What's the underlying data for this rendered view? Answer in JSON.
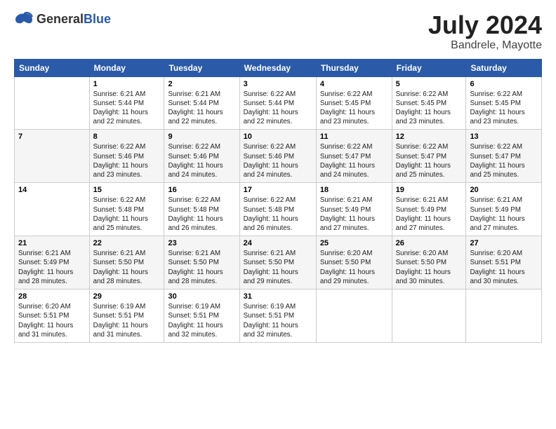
{
  "logo": {
    "general": "General",
    "blue": "Blue"
  },
  "title": "July 2024",
  "subtitle": "Bandrele, Mayotte",
  "days_of_week": [
    "Sunday",
    "Monday",
    "Tuesday",
    "Wednesday",
    "Thursday",
    "Friday",
    "Saturday"
  ],
  "weeks": [
    [
      {
        "day": "",
        "info": ""
      },
      {
        "day": "1",
        "info": "Sunrise: 6:21 AM\nSunset: 5:44 PM\nDaylight: 11 hours\nand 22 minutes."
      },
      {
        "day": "2",
        "info": "Sunrise: 6:21 AM\nSunset: 5:44 PM\nDaylight: 11 hours\nand 22 minutes."
      },
      {
        "day": "3",
        "info": "Sunrise: 6:22 AM\nSunset: 5:44 PM\nDaylight: 11 hours\nand 22 minutes."
      },
      {
        "day": "4",
        "info": "Sunrise: 6:22 AM\nSunset: 5:45 PM\nDaylight: 11 hours\nand 23 minutes."
      },
      {
        "day": "5",
        "info": "Sunrise: 6:22 AM\nSunset: 5:45 PM\nDaylight: 11 hours\nand 23 minutes."
      },
      {
        "day": "6",
        "info": "Sunrise: 6:22 AM\nSunset: 5:45 PM\nDaylight: 11 hours\nand 23 minutes."
      }
    ],
    [
      {
        "day": "7",
        "info": ""
      },
      {
        "day": "8",
        "info": "Sunrise: 6:22 AM\nSunset: 5:46 PM\nDaylight: 11 hours\nand 23 minutes."
      },
      {
        "day": "9",
        "info": "Sunrise: 6:22 AM\nSunset: 5:46 PM\nDaylight: 11 hours\nand 24 minutes."
      },
      {
        "day": "10",
        "info": "Sunrise: 6:22 AM\nSunset: 5:46 PM\nDaylight: 11 hours\nand 24 minutes."
      },
      {
        "day": "11",
        "info": "Sunrise: 6:22 AM\nSunset: 5:47 PM\nDaylight: 11 hours\nand 24 minutes."
      },
      {
        "day": "12",
        "info": "Sunrise: 6:22 AM\nSunset: 5:47 PM\nDaylight: 11 hours\nand 25 minutes."
      },
      {
        "day": "13",
        "info": "Sunrise: 6:22 AM\nSunset: 5:47 PM\nDaylight: 11 hours\nand 25 minutes."
      }
    ],
    [
      {
        "day": "14",
        "info": ""
      },
      {
        "day": "15",
        "info": "Sunrise: 6:22 AM\nSunset: 5:48 PM\nDaylight: 11 hours\nand 25 minutes."
      },
      {
        "day": "16",
        "info": "Sunrise: 6:22 AM\nSunset: 5:48 PM\nDaylight: 11 hours\nand 26 minutes."
      },
      {
        "day": "17",
        "info": "Sunrise: 6:22 AM\nSunset: 5:48 PM\nDaylight: 11 hours\nand 26 minutes."
      },
      {
        "day": "18",
        "info": "Sunrise: 6:21 AM\nSunset: 5:49 PM\nDaylight: 11 hours\nand 27 minutes."
      },
      {
        "day": "19",
        "info": "Sunrise: 6:21 AM\nSunset: 5:49 PM\nDaylight: 11 hours\nand 27 minutes."
      },
      {
        "day": "20",
        "info": "Sunrise: 6:21 AM\nSunset: 5:49 PM\nDaylight: 11 hours\nand 27 minutes."
      }
    ],
    [
      {
        "day": "21",
        "info": "Sunrise: 6:21 AM\nSunset: 5:49 PM\nDaylight: 11 hours\nand 28 minutes."
      },
      {
        "day": "22",
        "info": "Sunrise: 6:21 AM\nSunset: 5:50 PM\nDaylight: 11 hours\nand 28 minutes."
      },
      {
        "day": "23",
        "info": "Sunrise: 6:21 AM\nSunset: 5:50 PM\nDaylight: 11 hours\nand 28 minutes."
      },
      {
        "day": "24",
        "info": "Sunrise: 6:21 AM\nSunset: 5:50 PM\nDaylight: 11 hours\nand 29 minutes."
      },
      {
        "day": "25",
        "info": "Sunrise: 6:20 AM\nSunset: 5:50 PM\nDaylight: 11 hours\nand 29 minutes."
      },
      {
        "day": "26",
        "info": "Sunrise: 6:20 AM\nSunset: 5:50 PM\nDaylight: 11 hours\nand 30 minutes."
      },
      {
        "day": "27",
        "info": "Sunrise: 6:20 AM\nSunset: 5:51 PM\nDaylight: 11 hours\nand 30 minutes."
      }
    ],
    [
      {
        "day": "28",
        "info": "Sunrise: 6:20 AM\nSunset: 5:51 PM\nDaylight: 11 hours\nand 31 minutes."
      },
      {
        "day": "29",
        "info": "Sunrise: 6:19 AM\nSunset: 5:51 PM\nDaylight: 11 hours\nand 31 minutes."
      },
      {
        "day": "30",
        "info": "Sunrise: 6:19 AM\nSunset: 5:51 PM\nDaylight: 11 hours\nand 32 minutes."
      },
      {
        "day": "31",
        "info": "Sunrise: 6:19 AM\nSunset: 5:51 PM\nDaylight: 11 hours\nand 32 minutes."
      },
      {
        "day": "",
        "info": ""
      },
      {
        "day": "",
        "info": ""
      },
      {
        "day": "",
        "info": ""
      }
    ]
  ]
}
